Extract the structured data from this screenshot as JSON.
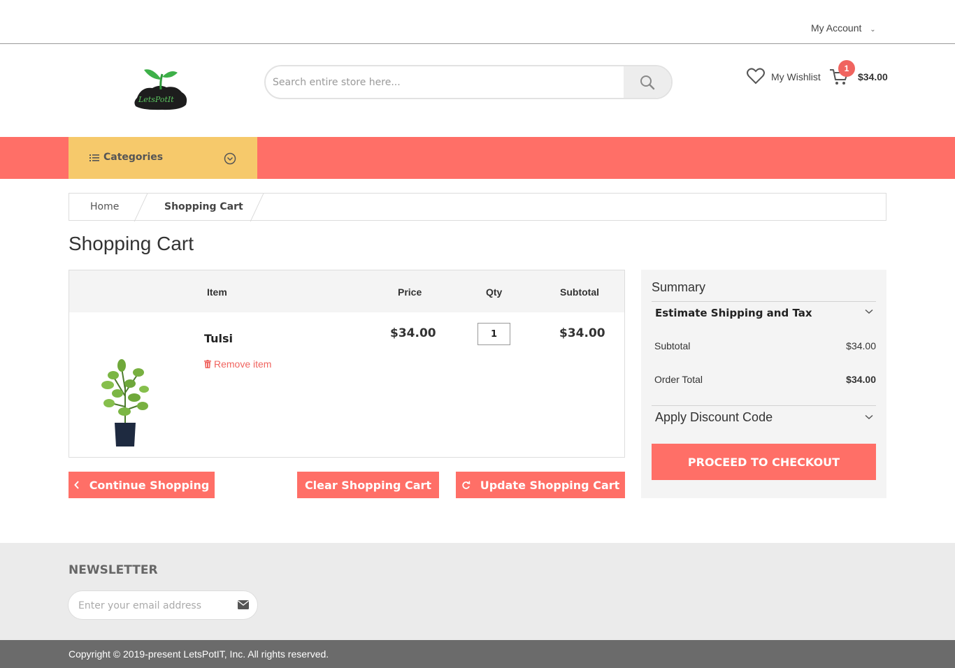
{
  "topbar": {
    "account_label": "My Account"
  },
  "header": {
    "logo_text": "LetsPotIt",
    "search_placeholder": "Search entire store here...",
    "wishlist_label": "My Wishlist",
    "cart_count": "1",
    "cart_total": "$34.00"
  },
  "nav": {
    "categories_label": "Categories"
  },
  "breadcrumb": {
    "home": "Home",
    "current": "Shopping Cart"
  },
  "page_title": "Shopping Cart",
  "cart": {
    "headers": {
      "item": "Item",
      "price": "Price",
      "qty": "Qty",
      "subtotal": "Subtotal"
    },
    "items": [
      {
        "name": "Tulsi",
        "remove_label": "Remove item",
        "price": "$34.00",
        "qty": "1",
        "subtotal": "$34.00"
      }
    ]
  },
  "actions": {
    "continue": "Continue Shopping",
    "clear": "Clear Shopping Cart",
    "update": "Update Shopping Cart"
  },
  "summary": {
    "title": "Summary",
    "estimate_label": "Estimate Shipping and Tax",
    "subtotal_label": "Subtotal",
    "subtotal_value": "$34.00",
    "order_total_label": "Order Total",
    "order_total_value": "$34.00",
    "discount_label": "Apply Discount Code",
    "checkout_label": "PROCEED TO CHECKOUT"
  },
  "footer": {
    "newsletter_title": "NEWSLETTER",
    "email_placeholder": "Enter your email address",
    "copyright": "Copyright © 2019-present LetsPotIT, Inc. All rights reserved."
  },
  "colors": {
    "accent": "#ff6f67",
    "categories_bg": "#f6c96b",
    "badge": "#f0645f"
  }
}
